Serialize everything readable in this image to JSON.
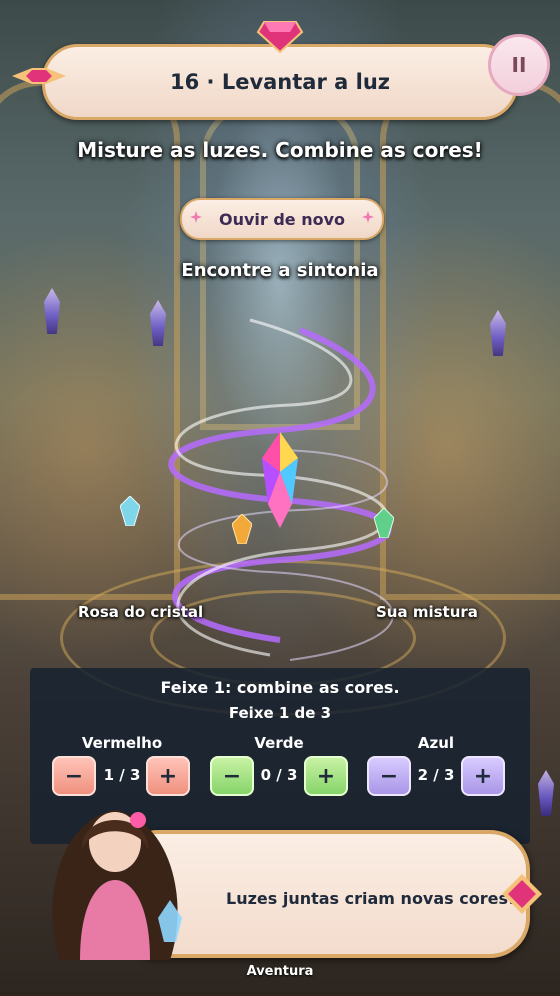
{
  "header": {
    "title": "16 · Levantar a luz",
    "pause_icon": "pause-icon",
    "pause_glyph": "II"
  },
  "instructions": {
    "headline": "Misture as luzes. Combine as cores!",
    "replay_label": "Ouvir de novo",
    "subhead": "Encontre a sintonia"
  },
  "crystal_scene": {
    "target_label": "Rosa do cristal",
    "mix_label": "Sua mistura"
  },
  "panel": {
    "title": "Feixe 1: combine as cores.",
    "progress": "Feixe 1 de 3",
    "channels": [
      {
        "name": "Vermelho",
        "value": "1 / 3",
        "color": "#f0907e"
      },
      {
        "name": "Verde",
        "value": "0 / 3",
        "color": "#86d46a"
      },
      {
        "name": "Azul",
        "value": "2 / 3",
        "color": "#a996e8"
      }
    ],
    "minus_glyph": "−",
    "plus_glyph": "+"
  },
  "dialog": {
    "text": "Luzes juntas criam novas cores!"
  },
  "footer": {
    "label": "Aventura"
  },
  "colors": {
    "banner": "#fbeee4",
    "banner_border": "#d9a766",
    "accent_pink": "#e0337a",
    "panel_bg": "#16222f"
  }
}
